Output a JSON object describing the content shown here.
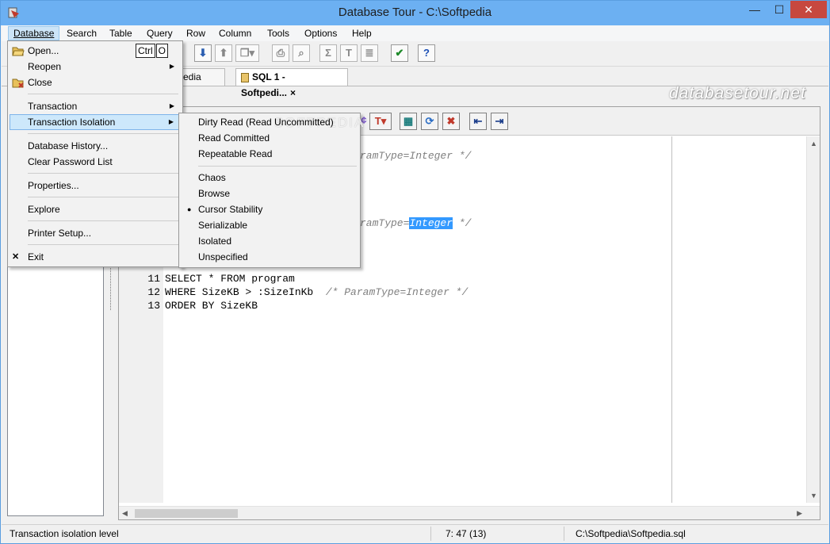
{
  "window": {
    "title": "Database Tour - C:\\Softpedia",
    "min": "—",
    "max": "☐",
    "close": "✕"
  },
  "menubar": {
    "items": [
      {
        "label": "Database",
        "key": "D"
      },
      {
        "label": "Search",
        "key": "S"
      },
      {
        "label": "Table",
        "key": "T"
      },
      {
        "label": "Query",
        "key": "Q"
      },
      {
        "label": "Row",
        "key": "R"
      },
      {
        "label": "Column",
        "key": "C"
      },
      {
        "label": "Tools",
        "key": "o"
      },
      {
        "label": "Options",
        "key": "O"
      },
      {
        "label": "Help",
        "key": "H"
      }
    ]
  },
  "watermark": "databasetour.net",
  "tabs": [
    {
      "label": "edia"
    },
    {
      "label": "SQL 1 - Softpedi...",
      "close": "×"
    }
  ],
  "database_menu": {
    "items": [
      {
        "label": "Open...",
        "shortcut_keys": [
          "Ctrl",
          "O"
        ]
      },
      {
        "label": "Reopen"
      },
      {
        "label": "Close"
      },
      {
        "label": "Transaction"
      },
      {
        "label": "Transaction Isolation"
      },
      {
        "label": "Database History..."
      },
      {
        "label": "Clear Password List"
      },
      {
        "label": "Properties..."
      },
      {
        "label": "Explore"
      },
      {
        "label": "Printer Setup..."
      },
      {
        "label": "Exit"
      }
    ]
  },
  "isolation_menu": {
    "watermark": "SOFTPEDIA",
    "items": [
      {
        "label": "Dirty Read (Read Uncommitted)"
      },
      {
        "label": "Read Committed"
      },
      {
        "label": "Repeatable Read"
      },
      {
        "label": "Chaos"
      },
      {
        "label": "Browse"
      },
      {
        "label": "Cursor Stability",
        "checked": true
      },
      {
        "label": "Serializable"
      },
      {
        "label": "Isolated"
      },
      {
        "label": "Unspecified"
      }
    ]
  },
  "editor": {
    "lines": [
      {
        "num": "",
        "code": "",
        "comment": "ramType=Integer */"
      },
      {
        "num": "",
        "code": "",
        "comment_pre": "ramType=",
        "highlight": "Integer",
        "comment_post": " */"
      },
      {
        "num": "11",
        "code": "SELECT * FROM program",
        "comment": ""
      },
      {
        "num": "12",
        "code": "WHERE SizeKB > :SizeInKb  ",
        "comment": "/* ParamType=Integer */"
      },
      {
        "num": "13",
        "code": "ORDER BY SizeKB",
        "comment": ""
      }
    ]
  },
  "statusbar": {
    "hint": "Transaction isolation level",
    "position": "7: 47 (13)",
    "file": "C:\\Softpedia\\Softpedia.sql"
  }
}
